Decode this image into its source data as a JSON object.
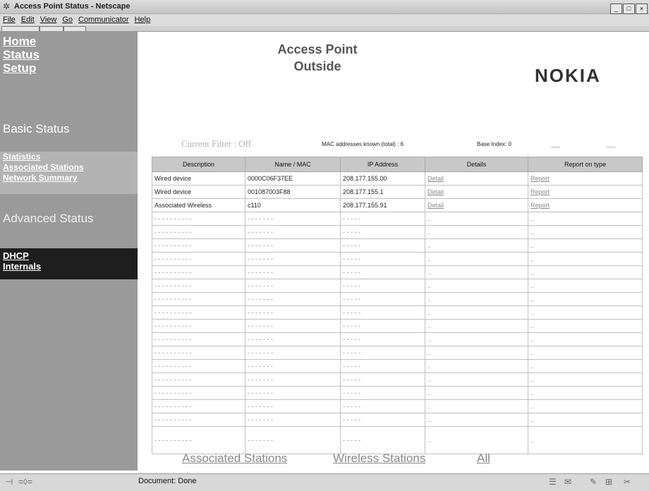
{
  "window": {
    "title": "Access Point Status - Netscape",
    "buttons": [
      "_",
      "□",
      "×"
    ]
  },
  "menu": [
    "File",
    "Edit",
    "View",
    "Go",
    "Communicator",
    "Help"
  ],
  "sidebar": {
    "nav": [
      "Home",
      "Status",
      "Setup"
    ],
    "basic_status_title": "Basic Status",
    "sub_links": [
      "Statistics",
      "Associated Stations",
      "Network Summary"
    ],
    "advanced_status_title": "Advanced Status",
    "advanced_links": [
      "DHCP",
      "Internals"
    ]
  },
  "header": {
    "line1": "Access Point",
    "line2": "Outside",
    "brand": "NOKIA"
  },
  "filter": {
    "current_filter": "Current Filter : Off",
    "mac_known": "MAC addresses known (total) : 6",
    "base_index": "Base Index: 0"
  },
  "table": {
    "headers": [
      "Description",
      "Name / MAC",
      "IP Address",
      "Details",
      "Report on type"
    ],
    "rows": [
      [
        "Wired device",
        "0000C06F37EE",
        "208.177.155.00",
        "Detail",
        "Report"
      ],
      [
        "Wired device",
        "001087003F88",
        "208.177.155.1",
        "Detail",
        "Report"
      ],
      [
        "Associated Wireless",
        "c110",
        "208.177.155.91",
        "Detail",
        "Report"
      ]
    ]
  },
  "bottom_links": [
    "Associated Stations",
    "Wireless Stations",
    "All"
  ],
  "status": {
    "text": "Document: Done"
  }
}
